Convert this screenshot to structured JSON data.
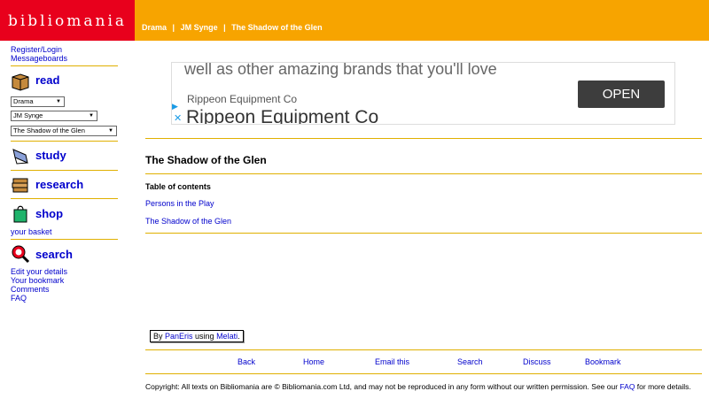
{
  "header": {
    "logo": "bibliomania",
    "breadcrumbs": [
      "Drama",
      "JM Synge",
      "The Shadow of the Glen"
    ],
    "separator": "|"
  },
  "sidebar": {
    "top_links": [
      "Register/Login",
      "Messageboards"
    ],
    "read_label": "read",
    "dropdowns": [
      "Drama",
      "JM Synge",
      "The Shadow of the Glen"
    ],
    "study_label": "study",
    "research_label": "research",
    "shop_label": "shop",
    "basket_link": "your basket",
    "search_label": "search",
    "bottom_links": [
      "Edit your details",
      "Your bookmark",
      "Comments",
      "FAQ"
    ]
  },
  "ad": {
    "tagline": "well as other amazing brands that you'll love",
    "advertiser_small": "Rippeon Equipment Co",
    "advertiser_big": "Rippeon Equipment Co",
    "button": "OPEN"
  },
  "main": {
    "title": "The Shadow of the Glen",
    "toc_heading": "Table of contents",
    "toc_items": [
      "Persons in the Play",
      "The Shadow of the Glen"
    ]
  },
  "credit": {
    "prefix": "By ",
    "author": "PanEris",
    "middle": " using ",
    "tool": "Melati",
    "suffix": "."
  },
  "footer_nav": [
    "Back",
    "Home",
    "Email this",
    "Search",
    "Discuss",
    "Bookmark"
  ],
  "copyright": {
    "text_before": "Copyright: All texts on Bibliomania are © Bibliomania.com Ltd, and may not be reproduced in any form without our written permission. See our ",
    "faq_link": "FAQ",
    "text_after": " for more details."
  },
  "colors": {
    "header_orange": "#f7a400",
    "logo_red": "#e8001c",
    "rule_gold": "#e0b000",
    "link_blue": "#0000cc"
  }
}
